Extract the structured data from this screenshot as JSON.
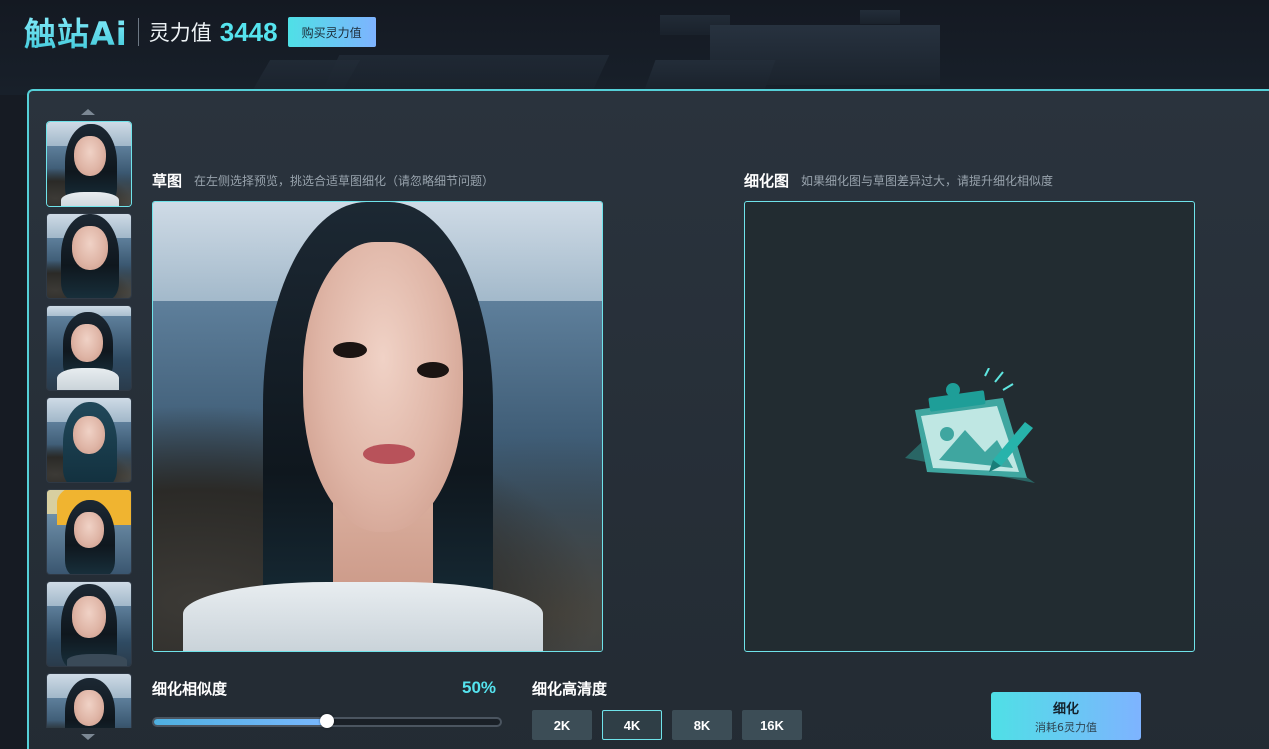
{
  "header": {
    "logo": "触站Ai",
    "spirit_label": "灵力值",
    "spirit_value": "3448",
    "buy_label": "购买灵力值"
  },
  "thumbnails": {
    "count": 7,
    "selected_index": 0
  },
  "sketch": {
    "title": "草图",
    "hint": "在左侧选择预览，挑选合适草图细化（请忽略细节问题）"
  },
  "refined": {
    "title": "细化图",
    "hint": "如果细化图与草图差异过大，请提升细化相似度"
  },
  "similarity": {
    "label": "细化相似度",
    "value_text": "50%",
    "value": 0.5
  },
  "resolution": {
    "label": "细化高清度",
    "options": [
      "2K",
      "4K",
      "8K",
      "16K"
    ],
    "selected": "4K"
  },
  "refine_button": {
    "label": "细化",
    "cost": "消耗6灵力值"
  },
  "colors": {
    "accent": "#55e3ee",
    "gradient_start": "#4fe0e6",
    "gradient_end": "#7eb3ff",
    "panel_bg": "#2a333d"
  }
}
